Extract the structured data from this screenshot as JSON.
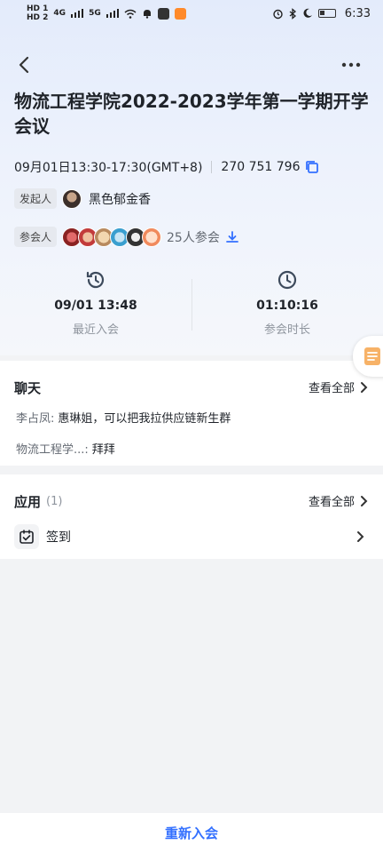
{
  "status_bar": {
    "hd1": "HD 1",
    "hd2": "HD 2",
    "net1": "4G",
    "net2": "5G",
    "time": "6:33",
    "icons": [
      "wifi-icon",
      "bell-icon",
      "app-icon",
      "app-orange-icon",
      "alarm-icon",
      "bluetooth-icon",
      "moon-icon",
      "battery-icon"
    ]
  },
  "nav": {
    "back_icon": "chevron-left-icon",
    "more_icon": "more-dots-icon"
  },
  "meeting": {
    "title": "物流工程学院2022-2023学年第一学期开学会议",
    "time": "09月01日13:30-17:30(GMT+8)",
    "meeting_id": "270 751 796",
    "host_tag": "发起人",
    "host_name": "黑色郁金香",
    "attendee_tag": "参会人",
    "attendee_count": "25人参会"
  },
  "stats": {
    "last_join_value": "09/01 13:48",
    "last_join_label": "最近入会",
    "duration_value": "01:10:16",
    "duration_label": "参会时长"
  },
  "chat": {
    "title": "聊天",
    "view_all": "查看全部",
    "messages": [
      {
        "sender": "李占凤:",
        "text": "惠琳姐，可以把我拉供应链新生群"
      },
      {
        "sender": "物流工程学...:",
        "text": "拜拜"
      }
    ]
  },
  "apps": {
    "title": "应用",
    "count": "(1)",
    "view_all": "查看全部",
    "items": [
      {
        "label": "签到",
        "icon": "calendar-check-icon"
      }
    ]
  },
  "footer": {
    "rejoin_label": "重新入会"
  },
  "colors": {
    "accent": "#3370ff",
    "text": "#1f2329",
    "muted": "#8f959e"
  }
}
